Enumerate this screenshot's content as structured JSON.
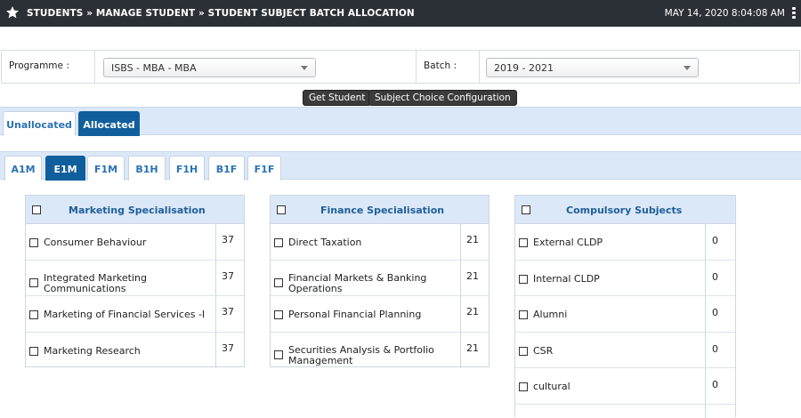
{
  "header": {
    "breadcrumb": "STUDENTS » MANAGE STUDENT » STUDENT SUBJECT BATCH ALLOCATION",
    "datetime": "MAY 14, 2020   8:04:08 AM"
  },
  "filters": {
    "programme_label": "Programme :",
    "programme_value": "ISBS - MBA - MBA",
    "batch_label": "Batch :",
    "batch_value": "2019 - 2021"
  },
  "actions": {
    "get_student": "Get Student",
    "subject_choice": "Subject Choice Configuration"
  },
  "allocation_tabs": [
    {
      "label": "Unallocated",
      "active": false
    },
    {
      "label": "Allocated",
      "active": true
    }
  ],
  "batch_tabs": [
    {
      "label": "A1M",
      "active": false
    },
    {
      "label": "E1M",
      "active": true
    },
    {
      "label": "F1M",
      "active": false
    },
    {
      "label": "B1H",
      "active": false
    },
    {
      "label": "F1H",
      "active": false
    },
    {
      "label": "B1F",
      "active": false
    },
    {
      "label": "F1F",
      "active": false
    }
  ],
  "panels": [
    {
      "title": "Marketing Specialisation",
      "rows": [
        {
          "name": "Consumer Behaviour",
          "count": "37"
        },
        {
          "name": "Integrated Marketing Communications",
          "count": "37"
        },
        {
          "name": "Marketing of Financial Services -I",
          "count": "37"
        },
        {
          "name": "Marketing Research",
          "count": "37"
        }
      ]
    },
    {
      "title": "Finance Specialisation",
      "rows": [
        {
          "name": "Direct Taxation",
          "count": "21"
        },
        {
          "name": "Financial Markets & Banking Operations",
          "count": "21"
        },
        {
          "name": "Personal Financial Planning",
          "count": "21"
        },
        {
          "name": "Securities Analysis & Portfolio Management",
          "count": "21"
        }
      ]
    },
    {
      "title": "Compulsory Subjects",
      "rows": [
        {
          "name": "External CLDP",
          "count": "0"
        },
        {
          "name": "Internal CLDP",
          "count": "0"
        },
        {
          "name": "Alumni",
          "count": "0"
        },
        {
          "name": "CSR",
          "count": "0"
        },
        {
          "name": "cultural",
          "count": "0"
        }
      ]
    }
  ],
  "colors": {
    "topbar": "#2b2f36",
    "tab_active": "#115e9c",
    "tabbar_bg": "#dbe8f7",
    "panel_title": "#1f5f9a"
  }
}
